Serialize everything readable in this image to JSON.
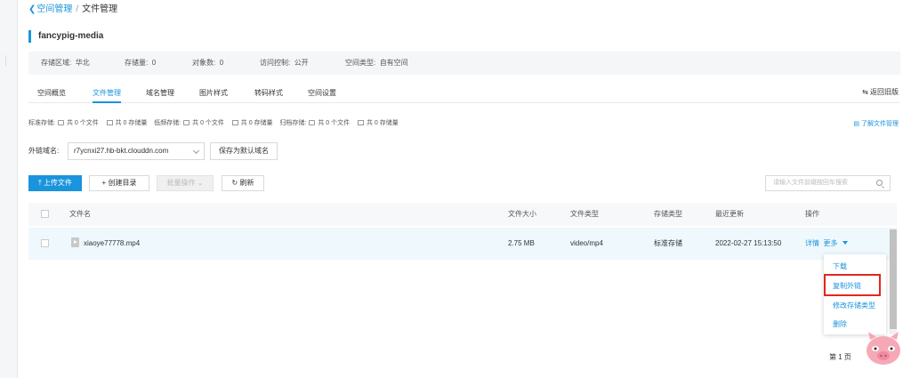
{
  "breadcrumb": {
    "parent": "空间管理",
    "separator": "/",
    "current": "文件管理"
  },
  "bucket": {
    "name": "fancypig-media"
  },
  "info": {
    "region_label": "存储区域:",
    "region_value": "华北",
    "storage_label": "存储量:",
    "storage_value": "0",
    "objects_label": "对象数:",
    "objects_value": "0",
    "access_label": "访问控制:",
    "access_value": "公开",
    "type_label": "空间类型:",
    "type_value": "自有空间"
  },
  "tabs": [
    {
      "label": "空间概览"
    },
    {
      "label": "文件管理"
    },
    {
      "label": "域名管理"
    },
    {
      "label": "图片样式"
    },
    {
      "label": "转码样式"
    },
    {
      "label": "空间设置"
    }
  ],
  "back_old": "返回旧版",
  "stats": {
    "standard_label": "标准存储:",
    "standard_files": "共 0 个文件",
    "standard_size": "共 0 存储量",
    "low_label": "低频存储:",
    "low_files": "共 0 个文件",
    "low_size": "共 0 存储量",
    "archive_label": "归档存储:",
    "archive_files": "共 0 个文件",
    "archive_size": "共 0 存储量"
  },
  "learn_link": "了解文件管理",
  "domain": {
    "label": "外链域名:",
    "value": "r7ycnxi27.hb-bkt.clouddn.com",
    "save_label": "保存为默认域名"
  },
  "toolbar": {
    "upload": "上传文件",
    "create_dir": "创建目录",
    "batch": "批量操作",
    "refresh": "刷新",
    "search_placeholder": "请输入文件前缀按回车搜索"
  },
  "table": {
    "headers": {
      "name": "文件名",
      "size": "文件大小",
      "type": "文件类型",
      "storage": "存储类型",
      "updated": "最近更新",
      "ops": "操作"
    },
    "rows": [
      {
        "name": "xiaoye77778.mp4",
        "size": "2.75 MB",
        "type": "video/mp4",
        "storage": "标准存储",
        "updated": "2022-02-27 15:13:50",
        "detail": "详情",
        "more": "更多"
      }
    ]
  },
  "menu": {
    "download": "下载",
    "copy_link": "复制外链",
    "change_storage": "修改存储类型",
    "delete": "删除"
  },
  "pagination": {
    "page": "第 1 页"
  },
  "colors": {
    "accent": "#1a94dc",
    "highlight": "#e0281e",
    "pig": "#f7a8b6"
  }
}
